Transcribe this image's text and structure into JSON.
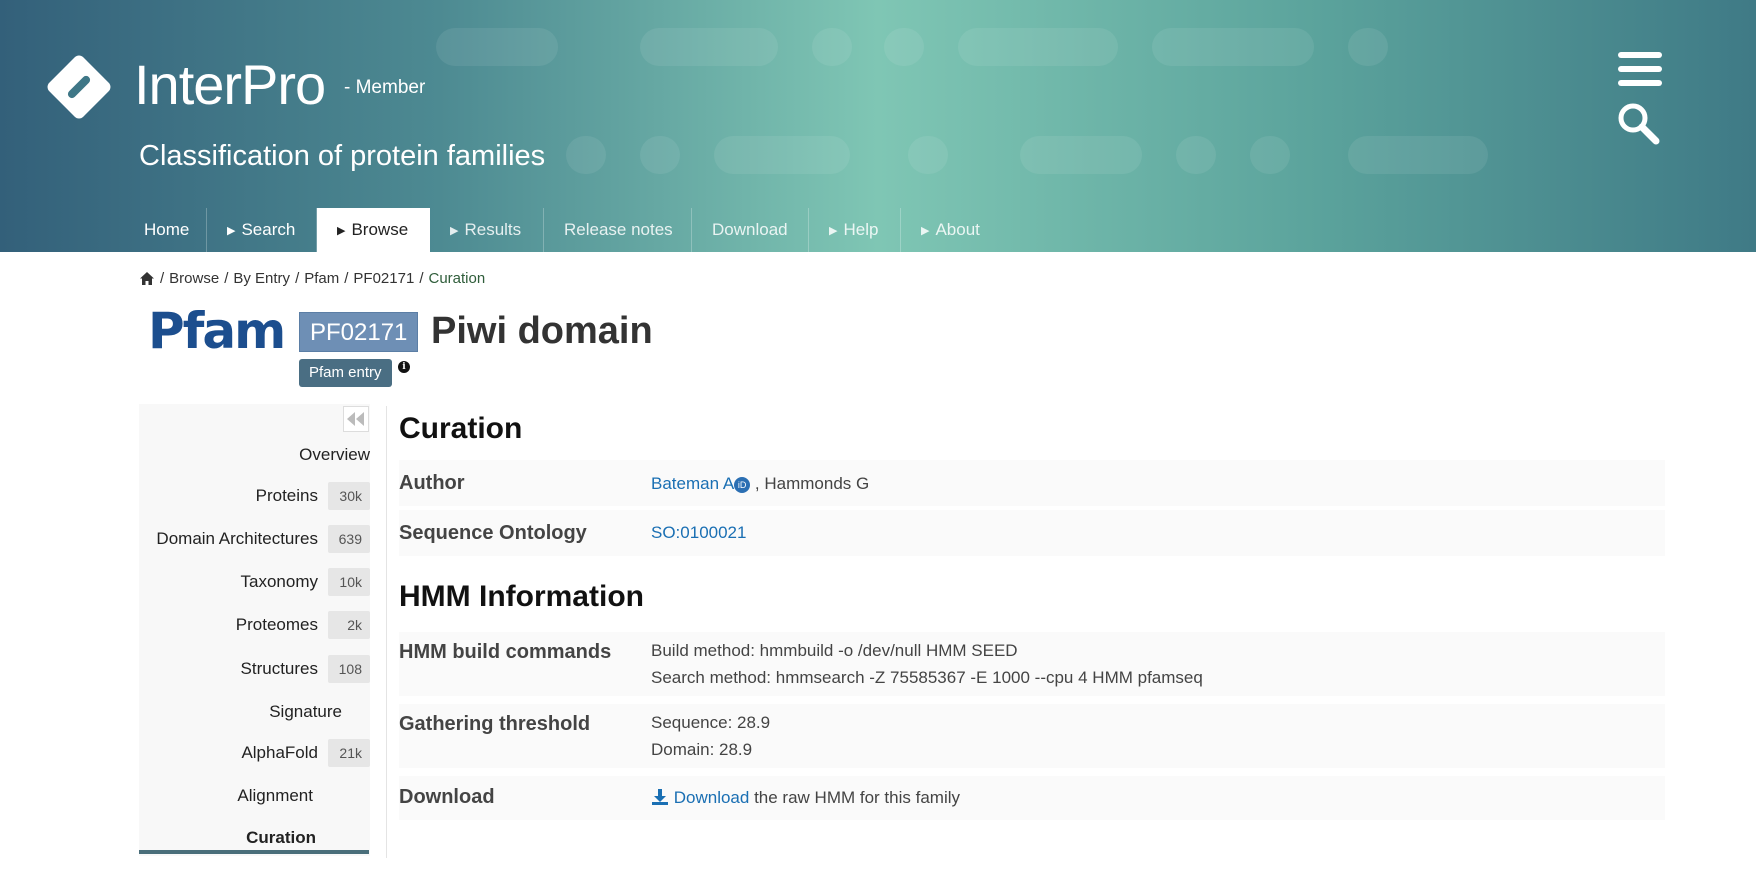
{
  "header": {
    "brand": "InterPro",
    "brand_suffix": "- Member",
    "subtitle": "Classification of protein families",
    "colors": {
      "gradient_start": "#33607a",
      "gradient_mid": "#7fc6b4",
      "gradient_end": "#3f7a86"
    }
  },
  "nav": {
    "items": [
      {
        "label": "Home",
        "caret": false
      },
      {
        "label": "Search",
        "caret": true
      },
      {
        "label": "Browse",
        "caret": true,
        "active": true
      },
      {
        "label": "Results",
        "caret": true
      },
      {
        "label": "Release notes",
        "caret": false
      },
      {
        "label": "Download",
        "caret": false
      },
      {
        "label": "Help",
        "caret": true
      },
      {
        "label": "About",
        "caret": true
      }
    ]
  },
  "breadcrumb": {
    "items": [
      "Browse",
      "By Entry",
      "Pfam",
      "PF02171"
    ],
    "current": "Curation",
    "separator": "/"
  },
  "entry": {
    "db_logo_text": "Pfam",
    "accession": "PF02171",
    "title": "Piwi domain",
    "badge": "Pfam entry"
  },
  "sidebar": {
    "items": [
      {
        "label": "Overview",
        "count": null
      },
      {
        "label": "Proteins",
        "count": "30k"
      },
      {
        "label": "Domain Architectures",
        "count": "639"
      },
      {
        "label": "Taxonomy",
        "count": "10k"
      },
      {
        "label": "Proteomes",
        "count": "2k"
      },
      {
        "label": "Structures",
        "count": "108"
      },
      {
        "label": "Signature",
        "count": null
      },
      {
        "label": "AlphaFold",
        "count": "21k"
      },
      {
        "label": "Alignment",
        "count": null
      },
      {
        "label": "Curation",
        "count": null,
        "active": true
      }
    ]
  },
  "curation": {
    "title": "Curation",
    "author_label": "Author",
    "author_primary": "Bateman A",
    "orcid_glyph": "iD",
    "author_rest": ", Hammonds G",
    "ontology_label": "Sequence Ontology",
    "ontology_value": "SO:0100021"
  },
  "hmm": {
    "title": "HMM Information",
    "build_label": "HMM build commands",
    "build_method": "Build method: hmmbuild -o /dev/null HMM SEED",
    "search_method": "Search method: hmmsearch -Z 75585367 -E 1000 --cpu 4 HMM pfamseq",
    "threshold_label": "Gathering threshold",
    "threshold_sequence": "Sequence: 28.9",
    "threshold_domain": "Domain: 28.9",
    "download_label": "Download",
    "download_link": "Download",
    "download_rest": "the raw HMM for this family"
  }
}
